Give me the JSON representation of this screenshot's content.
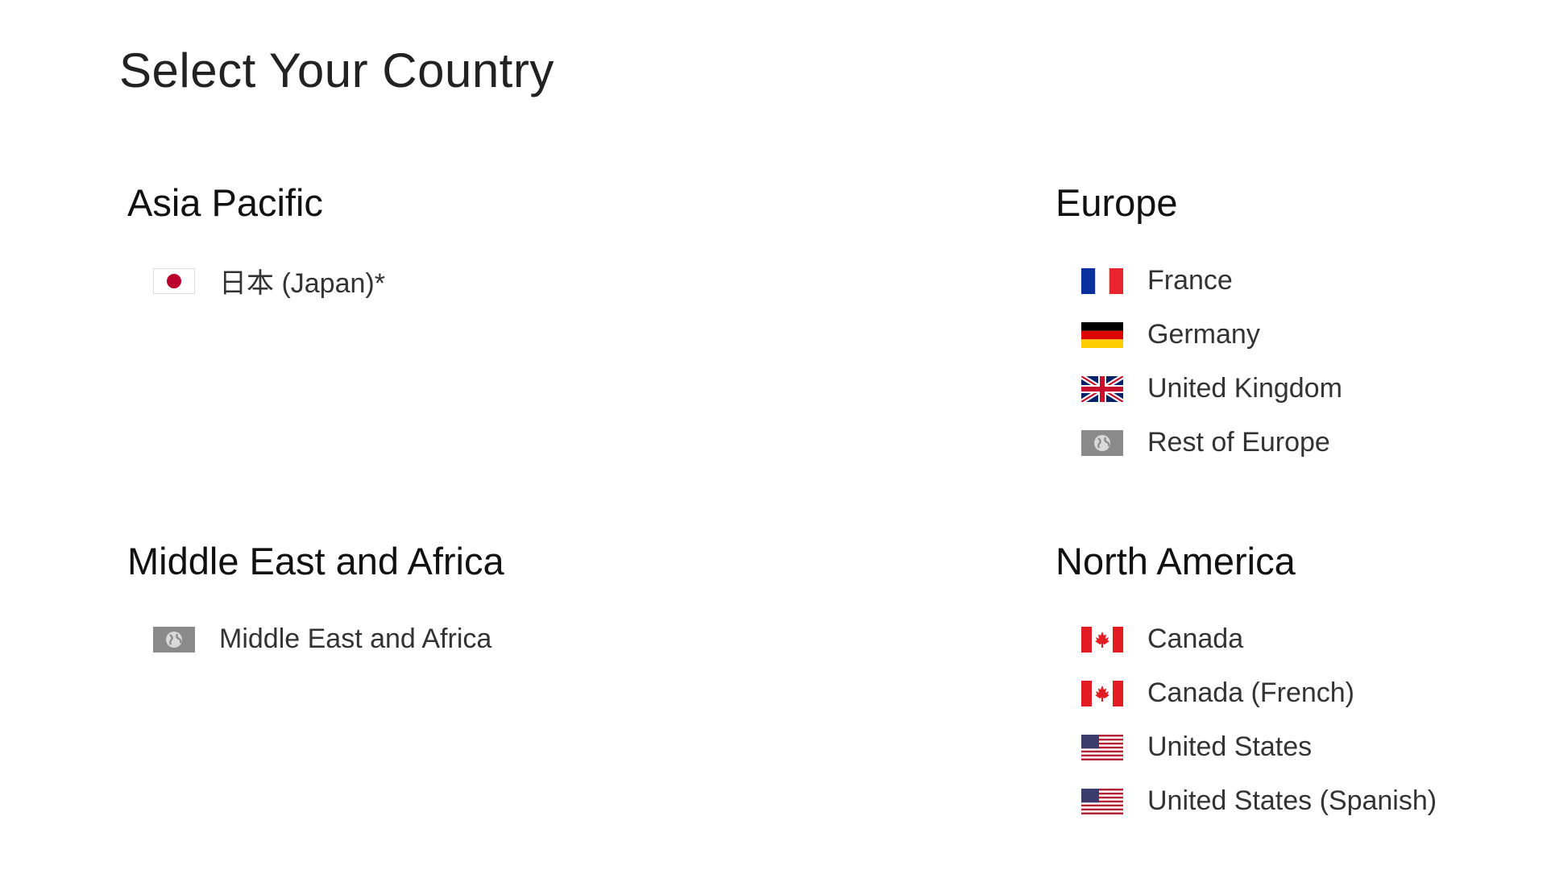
{
  "title": "Select Your Country",
  "regions": [
    {
      "heading": "Asia Pacific",
      "countries": [
        {
          "label": "日本 (Japan)*",
          "icon": "japan-flag-icon"
        }
      ]
    },
    {
      "heading": "Europe",
      "countries": [
        {
          "label": "France",
          "icon": "france-flag-icon"
        },
        {
          "label": "Germany",
          "icon": "germany-flag-icon"
        },
        {
          "label": "United Kingdom",
          "icon": "uk-flag-icon"
        },
        {
          "label": "Rest of Europe",
          "icon": "globe-icon"
        }
      ]
    },
    {
      "heading": "Middle East and Africa",
      "countries": [
        {
          "label": "Middle East and Africa",
          "icon": "globe-icon"
        }
      ]
    },
    {
      "heading": "North America",
      "countries": [
        {
          "label": "Canada",
          "icon": "canada-flag-icon"
        },
        {
          "label": "Canada (French)",
          "icon": "canada-flag-icon"
        },
        {
          "label": "United States",
          "icon": "us-flag-icon"
        },
        {
          "label": "United States (Spanish)",
          "icon": "us-flag-icon"
        }
      ]
    }
  ]
}
